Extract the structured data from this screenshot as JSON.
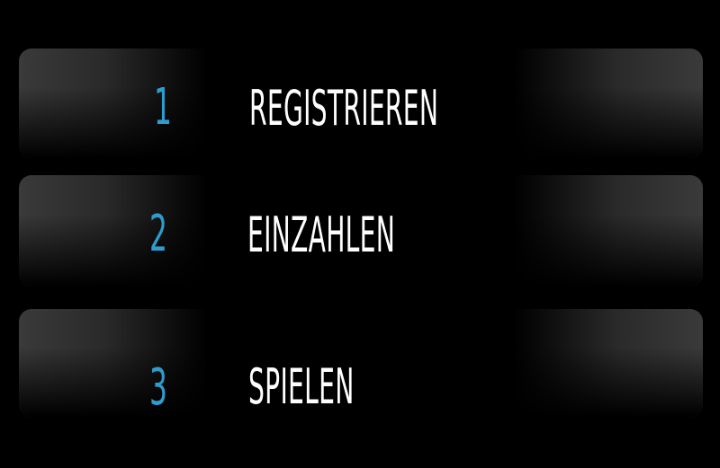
{
  "steps": [
    {
      "number": "1",
      "label": "REGISTRIEREN"
    },
    {
      "number": "2",
      "label": "EINZAHLEN"
    },
    {
      "number": "3",
      "label": "SPIELEN"
    }
  ],
  "colors": {
    "background": "#000000",
    "number_accent": "#2e9ccc",
    "label_text": "#ffffff",
    "card_highlight": "#3a3a3a"
  }
}
